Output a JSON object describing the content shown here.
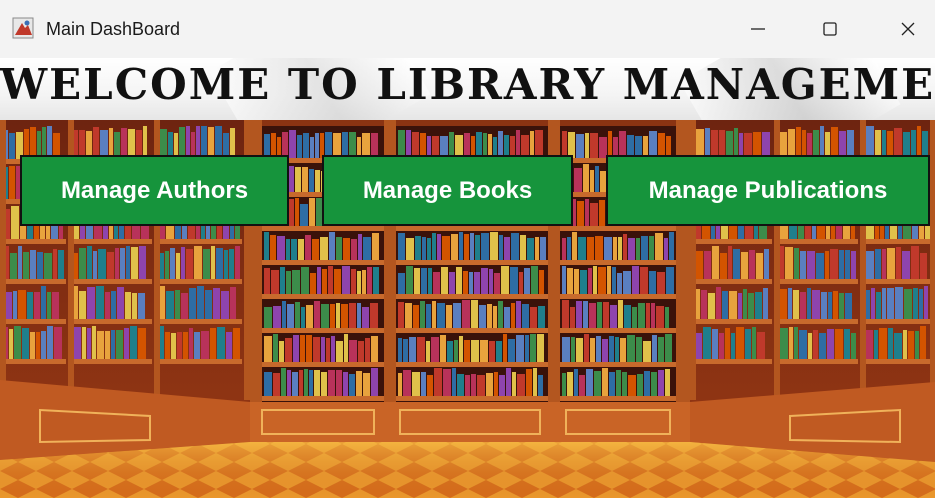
{
  "window": {
    "title": "Main DashBoard"
  },
  "banner": {
    "title": "Welcome to Library Management"
  },
  "buttons": {
    "authors": "Manage Authors",
    "books": "Manage Books",
    "publications": "Manage Publications"
  },
  "colors": {
    "button_bg": "#16943c",
    "floor": "#e07a20",
    "wood": "#b5531f"
  }
}
